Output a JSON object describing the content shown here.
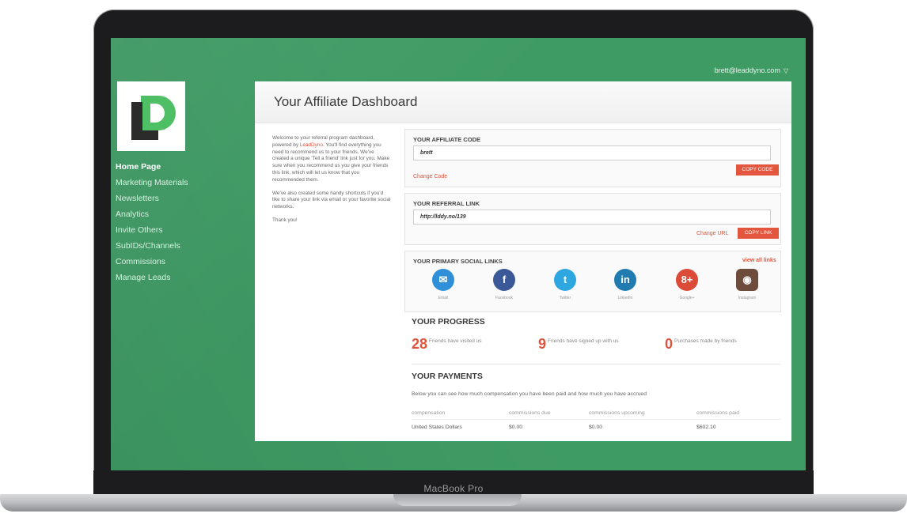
{
  "device": {
    "label": "MacBook Pro"
  },
  "colors": {
    "background_green": "#3f9b64",
    "accent_red": "#e4553e",
    "logo_green": "#4fbf66"
  },
  "user": {
    "email": "brett@leaddyno.com",
    "caret": "▽"
  },
  "sidebar": {
    "logo_icon": "leaddyno-logo",
    "items": [
      {
        "label": "Home Page",
        "active": true
      },
      {
        "label": "Marketing Materials"
      },
      {
        "label": "Newsletters"
      },
      {
        "label": "Analytics"
      },
      {
        "label": "Invite Others"
      },
      {
        "label": "SubIDs/Channels"
      },
      {
        "label": "Commissions"
      },
      {
        "label": "Manage Leads"
      }
    ]
  },
  "page": {
    "title": "Your Affiliate Dashboard"
  },
  "intro": {
    "p1_before": "Welcome to your referral program dashboard, powered by ",
    "p1_link": "LeadDyno",
    "p1_after": ". You'll find everything you need to recommend us to your friends. We've created a unique 'Tell a friend' link just for you. Make sure when you recommend us you give your friends this link, which will let us know that you recommended them.",
    "p2": "We've also created some handy shortcuts if you'd like to share your link via email or your favorite social networks.",
    "p3": "Thank you!"
  },
  "affiliate_code": {
    "title": "YOUR AFFILIATE CODE",
    "value": "brett",
    "copy_button": "COPY CODE",
    "change_link": "Change Code"
  },
  "referral_link": {
    "title": "YOUR REFERRAL LINK",
    "value": "http://lddy.no/139",
    "change_link": "Change URL",
    "copy_button": "COPY LINK"
  },
  "social": {
    "title": "YOUR PRIMARY SOCIAL LINKS",
    "view_all": "view all links",
    "items": [
      {
        "icon": "email-icon",
        "glyph": "✉",
        "label": "Email",
        "color": "#2f8fd8"
      },
      {
        "icon": "facebook-icon",
        "glyph": "f",
        "label": "Facebook",
        "color": "#3b5998"
      },
      {
        "icon": "twitter-icon",
        "glyph": "t",
        "label": "Twitter",
        "color": "#2ea7e0"
      },
      {
        "icon": "linkedin-icon",
        "glyph": "in",
        "label": "LinkedIn",
        "color": "#1f7bb0"
      },
      {
        "icon": "googleplus-icon",
        "glyph": "8+",
        "label": "Google+",
        "color": "#dc4a38"
      },
      {
        "icon": "instagram-icon",
        "glyph": "◉",
        "label": "Instagram",
        "color": "#6d4c3b"
      }
    ]
  },
  "progress": {
    "title": "YOUR PROGRESS",
    "stats": [
      {
        "value": "28",
        "label": "Friends have visited us"
      },
      {
        "value": "9",
        "label": "Friends have signed up with us"
      },
      {
        "value": "0",
        "label": "Purchases made by friends"
      }
    ]
  },
  "payments": {
    "title": "YOUR PAYMENTS",
    "description": "Below you can see how much compensation you have been paid and how much you have accrued",
    "columns": [
      "compensation",
      "commissions due",
      "commissions upcoming",
      "commissions paid"
    ],
    "rows": [
      [
        "United States Dollars",
        "$0.00",
        "$0.00",
        "$602.10"
      ]
    ]
  }
}
